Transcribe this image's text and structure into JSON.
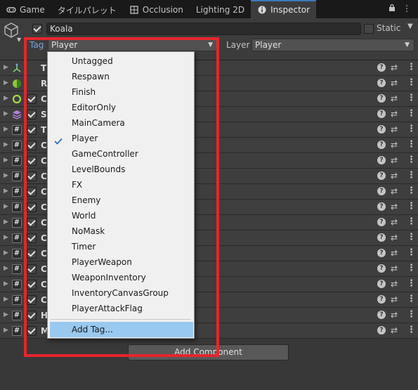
{
  "tabs": [
    {
      "label": "Game",
      "icon": "gamepad-icon"
    },
    {
      "label": "タイルパレット",
      "icon": ""
    },
    {
      "label": "Occlusion",
      "icon": "grid-icon"
    },
    {
      "label": "Lighting 2D",
      "icon": ""
    },
    {
      "label": "Inspector",
      "icon": "info-icon",
      "active": true
    }
  ],
  "tabbar_right": {
    "lock_icon": "🔒",
    "more_icon": "⋮"
  },
  "gameobject": {
    "active": true,
    "name": "Koala",
    "static_label": "Static",
    "static_checked": false,
    "tag_label": "Tag",
    "tag_value": "Player",
    "layer_label": "Layer",
    "layer_value": "Player"
  },
  "components": [
    {
      "name": "T",
      "icon": "transform-icon",
      "has_check": false
    },
    {
      "name": "R",
      "icon": "rigidbody-icon",
      "has_check": false
    },
    {
      "name": "C",
      "icon": "collider-icon",
      "has_check": true
    },
    {
      "name": "S",
      "icon": "sorting-icon",
      "has_check": true
    },
    {
      "name": "T",
      "icon": "script-icon",
      "has_check": true
    },
    {
      "name": "C",
      "icon": "script-icon",
      "has_check": true
    },
    {
      "name": "C",
      "icon": "script-icon",
      "has_check": true
    },
    {
      "name": "C",
      "icon": "script-icon",
      "has_check": true
    },
    {
      "name": "C",
      "icon": "script-icon",
      "has_check": true
    },
    {
      "name": "C",
      "icon": "script-icon",
      "has_check": true
    },
    {
      "name": "C",
      "icon": "script-icon",
      "has_check": true
    },
    {
      "name": "C",
      "icon": "script-icon",
      "has_check": true
    },
    {
      "name": "C",
      "icon": "script-icon",
      "has_check": true
    },
    {
      "name": "C",
      "icon": "script-icon",
      "has_check": true
    },
    {
      "name": "C",
      "icon": "script-icon",
      "has_check": true
    },
    {
      "name": "C",
      "icon": "script-icon",
      "has_check": true
    },
    {
      "name": "H",
      "icon": "script-icon",
      "has_check": true
    },
    {
      "name": "M",
      "icon": "script-icon",
      "has_check": true
    }
  ],
  "add_component_label": "Add Component",
  "tag_menu": {
    "items": [
      "Untagged",
      "Respawn",
      "Finish",
      "EditorOnly",
      "MainCamera",
      "Player",
      "GameController",
      "LevelBounds",
      "FX",
      "Enemy",
      "World",
      "NoMask",
      "Timer",
      "PlayerWeapon",
      "WeaponInventory",
      "InventoryCanvasGroup",
      "PlayerAttackFlag"
    ],
    "selected": "Player",
    "add_tag_label": "Add Tag..."
  },
  "colors": {
    "highlight_box": "#e5262c",
    "menu_highlight": "#99c9ef",
    "tag_label": "#7ba6d8",
    "active_tab_accent": "#3a79bb"
  }
}
